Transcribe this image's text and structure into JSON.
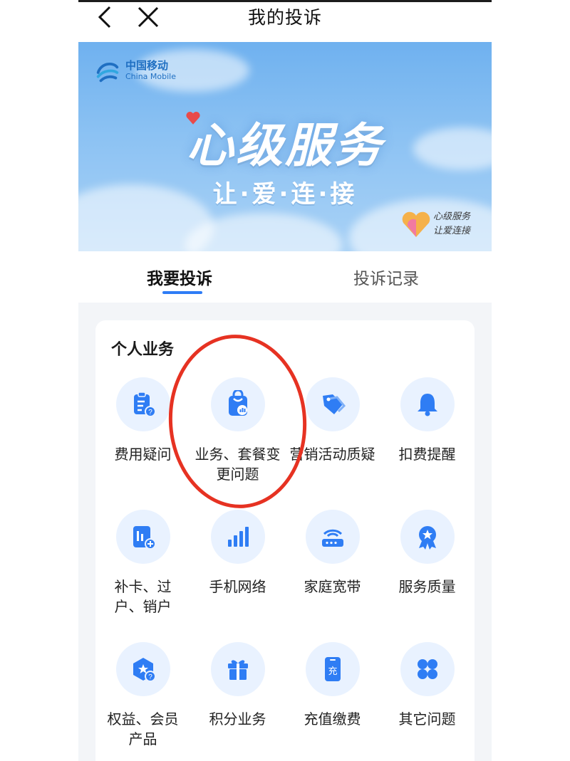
{
  "nav": {
    "title": "我的投诉"
  },
  "banner": {
    "brand_cn": "中国移动",
    "brand_en": "China Mobile",
    "title": "心级服务",
    "subtitle": "让·爱·连·接",
    "mini_slogan_line1": "心级服务",
    "mini_slogan_line2": "让爱连接"
  },
  "tabs": [
    {
      "label": "我要投诉",
      "active": true
    },
    {
      "label": "投诉记录",
      "active": false
    }
  ],
  "section": {
    "title": "个人业务"
  },
  "items": [
    {
      "label": "费用疑问",
      "icon": "billing-icon"
    },
    {
      "label": "业务、套餐变更问题",
      "icon": "package-icon"
    },
    {
      "label": "营销活动质疑",
      "icon": "tag-icon"
    },
    {
      "label": "扣费提醒",
      "icon": "bell-icon"
    },
    {
      "label": "补卡、过户、销户",
      "icon": "sim-card-icon"
    },
    {
      "label": "手机网络",
      "icon": "signal-icon"
    },
    {
      "label": "家庭宽带",
      "icon": "router-icon"
    },
    {
      "label": "服务质量",
      "icon": "medal-icon"
    },
    {
      "label": "权益、会员产品",
      "icon": "membership-icon"
    },
    {
      "label": "积分业务",
      "icon": "gift-icon"
    },
    {
      "label": "充值缴费",
      "icon": "recharge-icon"
    },
    {
      "label": "其它问题",
      "icon": "grid-icon"
    }
  ],
  "colors": {
    "accent": "#2e7cf6",
    "icon": "#2f7df4",
    "icon_bg": "#e9f2ff",
    "annotation": "#e63222"
  }
}
